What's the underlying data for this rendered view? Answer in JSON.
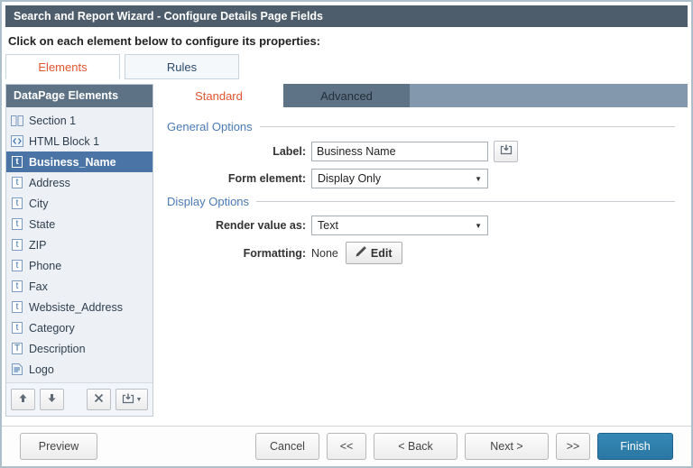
{
  "title": "Search and Report Wizard - Configure Details Page Fields",
  "instruction": "Click on each element below to configure its properties:",
  "main_tabs": [
    {
      "label": "Elements",
      "active": true
    },
    {
      "label": "Rules",
      "active": false
    }
  ],
  "sidebar": {
    "header": "DataPage Elements",
    "items": [
      {
        "label": "Section 1",
        "icon": "section",
        "selected": false
      },
      {
        "label": "HTML Block 1",
        "icon": "html",
        "selected": false
      },
      {
        "label": "Business_Name",
        "icon": "text",
        "selected": true
      },
      {
        "label": "Address",
        "icon": "text",
        "selected": false
      },
      {
        "label": "City",
        "icon": "text",
        "selected": false
      },
      {
        "label": "State",
        "icon": "text",
        "selected": false
      },
      {
        "label": "ZIP",
        "icon": "text",
        "selected": false
      },
      {
        "label": "Phone",
        "icon": "text",
        "selected": false
      },
      {
        "label": "Fax",
        "icon": "text",
        "selected": false
      },
      {
        "label": "Websiste_Address",
        "icon": "text",
        "selected": false
      },
      {
        "label": "Category",
        "icon": "text",
        "selected": false
      },
      {
        "label": "Description",
        "icon": "textarea",
        "selected": false
      },
      {
        "label": "Logo",
        "icon": "file",
        "selected": false
      }
    ],
    "toolbar": {
      "move_up": "up-arrow",
      "move_down": "down-arrow",
      "delete": "x",
      "insert": "insert-arrow-with-caret"
    }
  },
  "panel": {
    "tabs": [
      {
        "label": "Standard",
        "active": true
      },
      {
        "label": "Advanced",
        "active": false
      }
    ],
    "sections": {
      "general": "General Options",
      "display": "Display Options"
    },
    "fields": {
      "label": {
        "label": "Label:",
        "value": "Business Name"
      },
      "form_element": {
        "label": "Form element:",
        "value": "Display Only"
      },
      "render_value_as": {
        "label": "Render value as:",
        "value": "Text"
      },
      "formatting": {
        "label": "Formatting:",
        "value": "None",
        "edit_label": "Edit"
      }
    }
  },
  "footer": {
    "preview": "Preview",
    "cancel": "Cancel",
    "first": "<<",
    "back": "< Back",
    "next": "Next >",
    "last": ">>",
    "finish": "Finish"
  },
  "colors": {
    "titlebar": "#4e5d6c",
    "accent_orange": "#e2552e",
    "selected_row": "#4a73a6",
    "panel_tabbar": "#8398ac",
    "sidebar_header": "#5e7285",
    "finish_button": "#2e7fae",
    "section_title": "#4a7ab5"
  }
}
